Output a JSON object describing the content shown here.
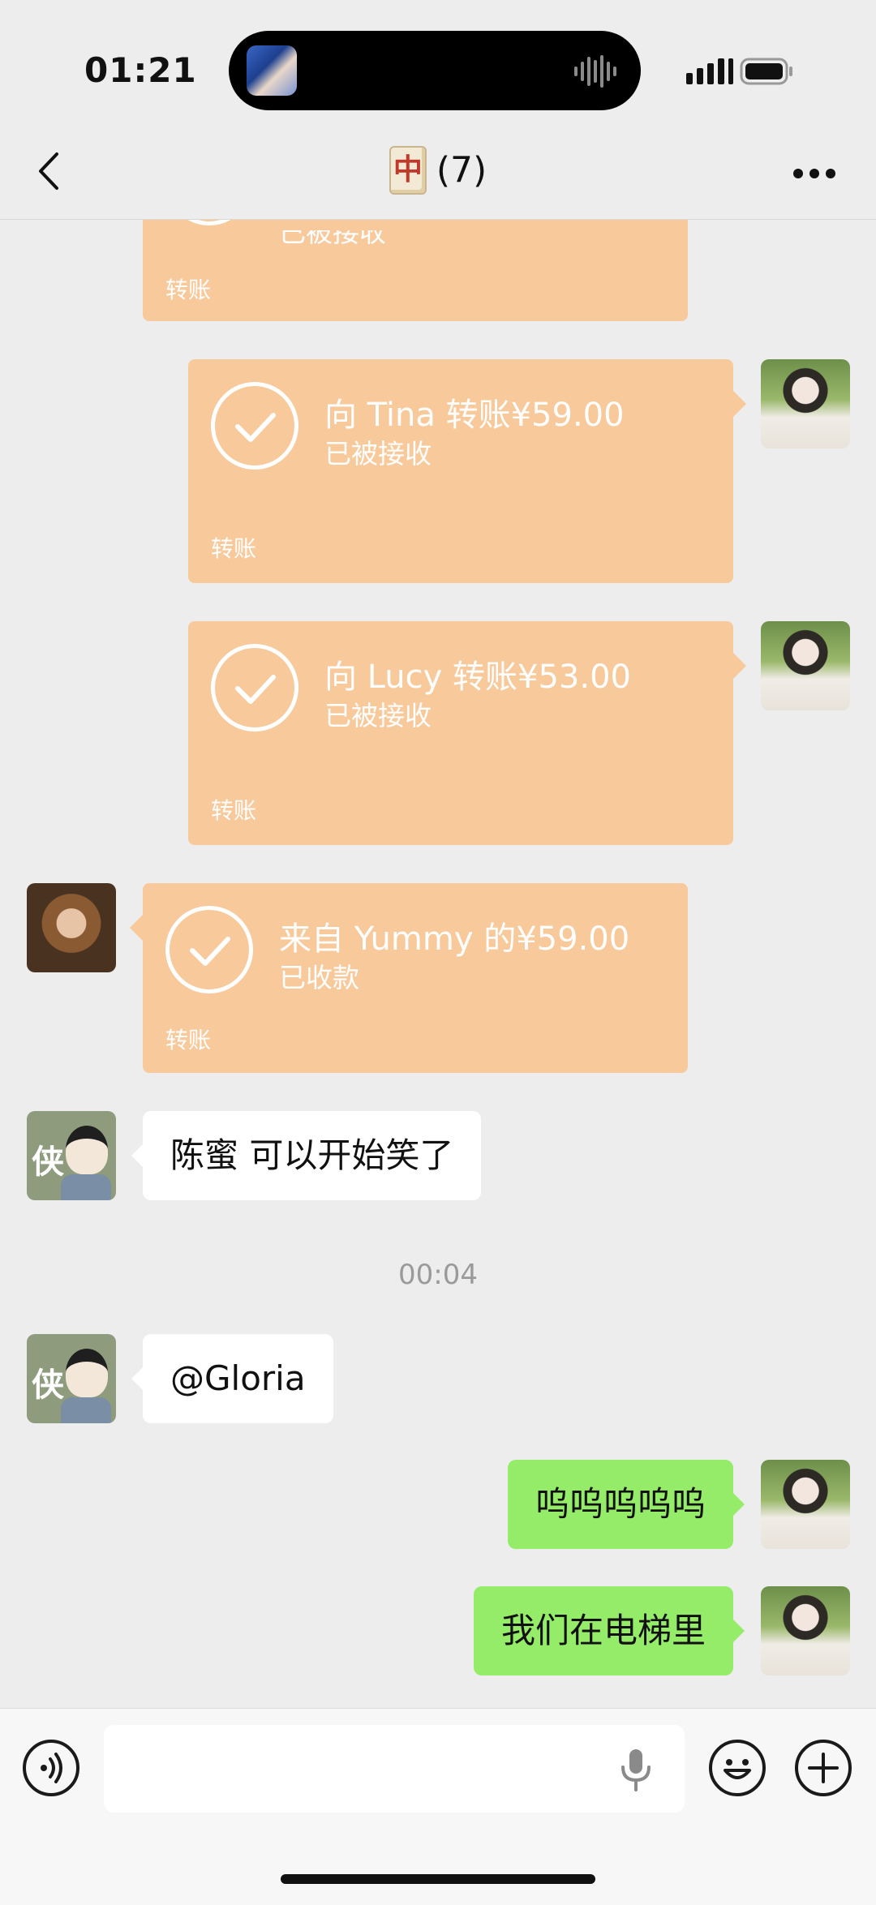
{
  "status_bar": {
    "time": "01:21"
  },
  "header": {
    "title": "(7)",
    "emoji_char": "中"
  },
  "messages": {
    "partial_card": {
      "status": "已被接收",
      "label": "转账"
    },
    "card_tina": {
      "main": "向 Tina 转账¥59.00",
      "status": "已被接收",
      "label": "转账"
    },
    "card_lucy": {
      "main": "向 Lucy 转账¥53.00",
      "status": "已被接收",
      "label": "转账"
    },
    "card_yummy": {
      "main": "来自 Yummy 的¥59.00",
      "status": "已收款",
      "label": "转账"
    },
    "text_chenmi": "陈蜜 可以开始笑了",
    "timestamp": "00:04",
    "text_gloria": "@Gloria",
    "text_wuwu": "呜呜呜呜呜",
    "text_elevator": "我们在电梯里"
  },
  "avatars": {
    "xia_char": "侠"
  },
  "colors": {
    "transfer_card": "#f8c99a",
    "my_bubble": "#95ec69",
    "their_bubble": "#ffffff",
    "background": "#ededed"
  },
  "icons": [
    "back-chevron-icon",
    "more-dots-icon",
    "voice-input-icon",
    "microphone-icon",
    "emoji-icon",
    "plus-icon",
    "check-icon"
  ]
}
